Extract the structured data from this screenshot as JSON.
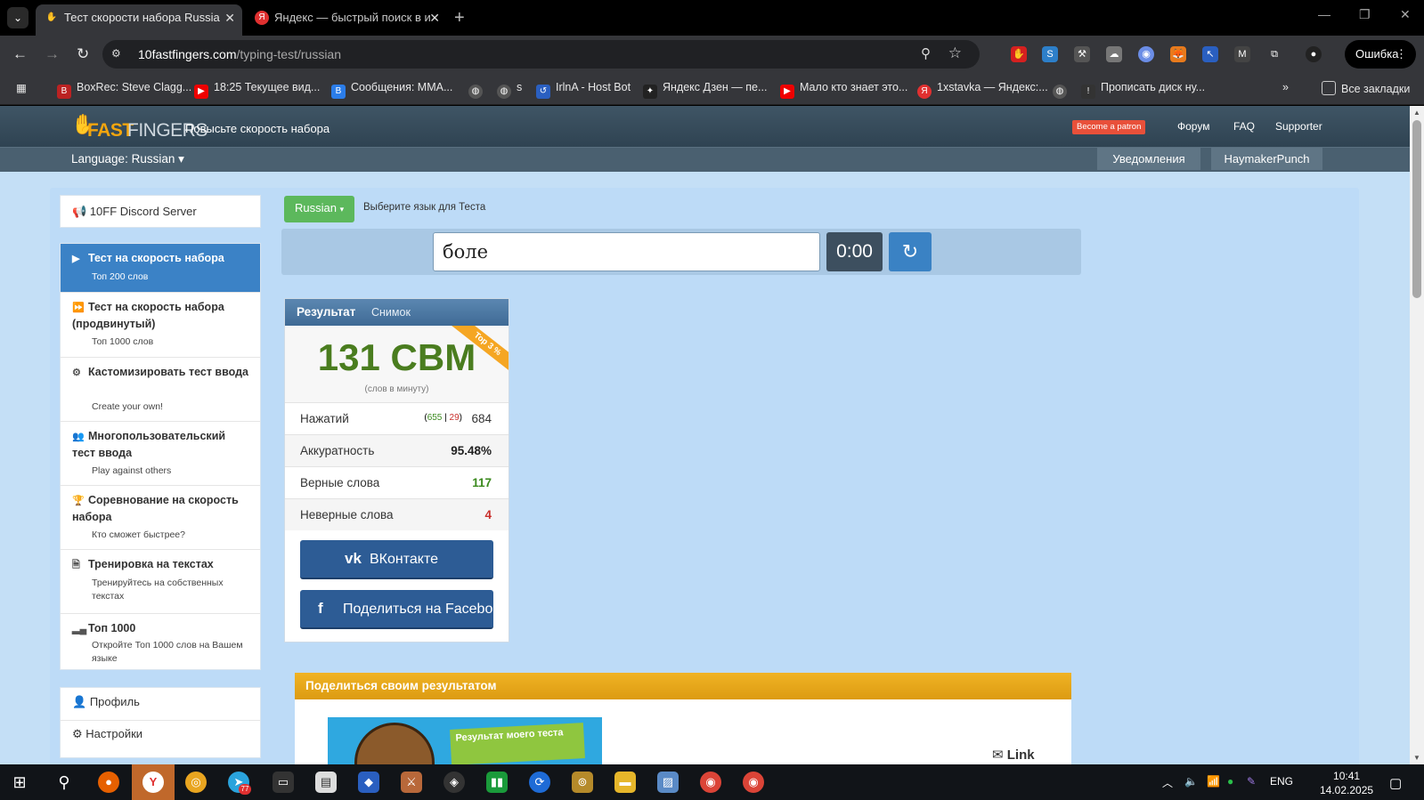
{
  "browser": {
    "tabs": [
      {
        "title": "Тест скорости набора Russian",
        "active": true
      },
      {
        "title": "Яндекс — быстрый поиск в ин",
        "active": false
      }
    ],
    "url_host": "10fastfingers.com",
    "url_path": "/typing-test/russian",
    "error_label": "Ошибка",
    "bookmarks": [
      "BoxRec: Steve Clagg...",
      "18:25 Текущее вид...",
      "Сообщения: MMA...",
      "s",
      "IrlnA - Host Bot",
      "Яндекс Дзен — пе...",
      "Мало кто знает это...",
      "1xstavka — Яндекс:...",
      "Прописать диск ну..."
    ],
    "all_bookmarks": "Все закладки"
  },
  "site": {
    "logo_fast": "FAST",
    "logo_fingers": "FINGERS",
    "tagline": "Повысьте скорость набора",
    "patron": "Become a patron",
    "links": [
      "Форум",
      "FAQ",
      "Supporter"
    ],
    "language_label": "Language: Russian",
    "notifications": "Уведомления",
    "username": "HaymakerPunch"
  },
  "sidebar": {
    "discord": "10FF Discord Server",
    "items": [
      {
        "title": "Тест на скорость набора",
        "sub": "Топ 200 слов"
      },
      {
        "title": "Тест на скорость набора (продвинутый)",
        "sub": "Топ 1000 слов"
      },
      {
        "title": "Кастомизировать тест ввода",
        "sub": "Create your own!"
      },
      {
        "title": "Многопользовательский тест ввода",
        "sub": "Play against others"
      },
      {
        "title": "Соревнование на скорость набора",
        "sub": "Кто сможет быстрее?"
      },
      {
        "title": "Тренировка на текстах",
        "sub": "Тренируйтесь на собственных текстах"
      },
      {
        "title": "Топ 1000",
        "sub": "Откройте Топ 1000 слов на Вашем языке"
      }
    ],
    "profile": "Профиль",
    "settings": "Настройки"
  },
  "test": {
    "lang_button": "Russian",
    "lang_hint": "Выберите язык для Теста",
    "input_value": "боле",
    "timer": "0:00"
  },
  "result": {
    "tab_result": "Результат",
    "tab_snapshot": "Снимок",
    "wpm": "131 СВМ",
    "wpm_sub": "(слов в минуту)",
    "ribbon": "Top 3 %",
    "keystrokes_label": "Нажатий",
    "keystrokes_ok": "655",
    "keystrokes_bad": "29",
    "keystrokes_total": "684",
    "accuracy_label": "Аккуратность",
    "accuracy": "95.48%",
    "correct_label": "Верные слова",
    "correct": "117",
    "wrong_label": "Неверные слова",
    "wrong": "4",
    "vk_button": "ВКонтакте",
    "fb_button": "Поделиться на Facebook"
  },
  "share": {
    "heading": "Поделиться своим результатом",
    "image_caption": "Результат моего теста",
    "link_label": "Link"
  },
  "taskbar": {
    "lang": "ENG",
    "time": "10:41",
    "date": "14.02.2025",
    "telegram_badge": "77"
  },
  "colors": {
    "accent_blue": "#3b82c6",
    "wpm_green": "#4a7d1f",
    "share_orange": "#f0b324",
    "error_red": "#c9302c"
  }
}
